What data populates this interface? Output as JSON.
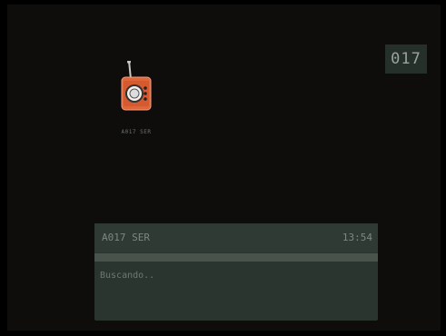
{
  "channel_number": "017",
  "radio_icon": {
    "name": "radio-icon",
    "caption": "A017 SER",
    "color": "#e0663a"
  },
  "info_panel": {
    "station": "A017 SER",
    "time": "13:54",
    "status": "Buscando..",
    "progress": 1.0
  },
  "colors": {
    "background": "#0f0d0c",
    "panel": "#2a3530",
    "badge": "#26302a",
    "text": "#7e877f"
  }
}
